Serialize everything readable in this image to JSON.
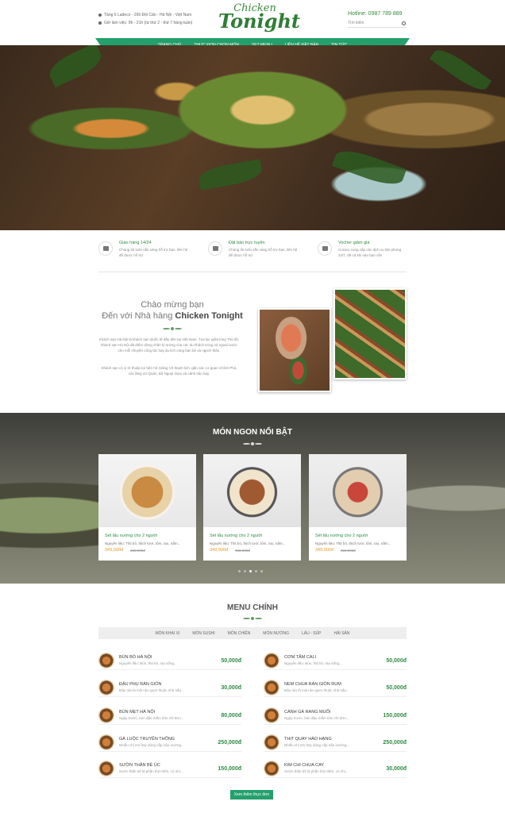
{
  "header": {
    "address": "Tầng 6 Ladeco - 266 Đội Cấn - Hà Nội - Việt Nam",
    "hours": "Giờ làm việc: 9h - 21h (từ thứ 2 - thứ 7 hàng tuần)",
    "logo_line1": "Chicken",
    "logo_line2": "Tonight",
    "hotline": "Hotline: 0987 789 889",
    "search_placeholder": "Tìm kiếm"
  },
  "nav": [
    "TRANG CHỦ",
    "THỰC ĐƠN CHỌN MÓN",
    "SET MENU",
    "LIÊN HỆ ĐẶT BÀN",
    "TIN TỨC"
  ],
  "features": [
    {
      "title": "Giao hàng 14/24",
      "desc": "Chúng tôi luôn sẵn sàng hỗ trợ bạn, liên hệ để được hỗ trợ",
      "icon": "delivery-icon"
    },
    {
      "title": "Đặt bàn trực tuyến",
      "desc": "Chúng tôi luôn sẵn sàng hỗ trợ bạn, liên hệ để được hỗ trợ",
      "icon": "table-icon"
    },
    {
      "title": "Vocher giảm giá",
      "desc": "Coravo cung cấp các dịch vụ tận phòng 24/7, tất cả khi nào bạn cần",
      "icon": "voucher-icon"
    }
  ],
  "welcome": {
    "line1": "Chào mừng bạn",
    "line2_prefix": "Đến với Nhà hàng ",
    "line2_brand": "Chicken Tonight",
    "para1": "Khách sạn Hà Nội là khách sạn Quốc tế đầu tiên tại Việt Nam. Tọa lạc giữa lòng Thủ đô, khách sạn Hà Nội đã điểm dừng chân lý tưởng của các du khách trong và ngoài nước cho mỗi chuyến công tác hay du lịch cùng bạn bè và người thân.",
    "para2": "Khách sạn có vị trí thuận lợi bên hồ Giảng Võ thanh lịch, gần các cơ quan Chính Phủ, các lăng sứ Quán, Bộ Ngoại Giao và cảnh sân bay."
  },
  "featured": {
    "title": "MÓN NGON NỔI BẬT",
    "cards": [
      {
        "name": "Sét lẩu nướng cho 2 người",
        "desc": "Nguyên liệu: Thịt bò, thịch tươi, tôm, rau, nấm...",
        "price": "349,000đ",
        "old_price": "450,000đ"
      },
      {
        "name": "Sét lẩu nướng cho 2 người",
        "desc": "Nguyên liệu: Thịt bò, thịch tươi, tôm, rau, nấm...",
        "price": "349,000đ",
        "old_price": "450,000đ"
      },
      {
        "name": "Sét lẩu nướng cho 2 người",
        "desc": "Nguyên liệu: Thịt bò, thịch tươi, tôm, rau, nấm...",
        "price": "349,000đ",
        "old_price": "450,000đ"
      }
    ]
  },
  "menu": {
    "title": "MENU CHÍNH",
    "tabs": [
      "MÓN KHAI VỊ",
      "MÓN SUSHI",
      "MÓN CHIÊN",
      "MÓN NƯỚNG",
      "LẨU - SÚP",
      "HẢI SẢN"
    ],
    "left": [
      {
        "name": "BÚN BÒ HÀ NỘI",
        "desc": "Nguyên liệu: Bún, thịt bò, rau sống...",
        "price": "50,000đ"
      },
      {
        "name": "ĐẬU PHỤ RÁN GIÒN",
        "desc": "Đậu rán là món ăn quen thuộc nhà nấu...",
        "price": "30,000đ"
      },
      {
        "name": "BÚN MẸT HÀ NỘI",
        "desc": "Ngày trước, bún đậu mắm tôm chỉ đơn...",
        "price": "80,000đ"
      },
      {
        "name": "GÀ LUỘC TRUYỀN THỐNG",
        "desc": "Nhiều chị em hay dùng cấp nấu nướng...",
        "price": "250,000đ"
      },
      {
        "name": "SƯỜN THĂN BÊ ÚC",
        "desc": "Sườn thăn bê là phần thịt mềm, có nhi...",
        "price": "150,000đ"
      }
    ],
    "right": [
      {
        "name": "CƠM TẤM CALI",
        "desc": "Nguyên liệu: Bún, thịt bò, rau sống...",
        "price": "50,000đ"
      },
      {
        "name": "NEM CHUA RÁN GIÒN RUM",
        "desc": "Đậu rán là món ăn quen thuộc nhà nấu...",
        "price": "50,000đ"
      },
      {
        "name": "CÁNH GÀ RANG MUỐI",
        "desc": "Ngày trước, bún đậu mắm tôm chỉ đơn...",
        "price": "150,000đ"
      },
      {
        "name": "THỊT QUAY HÀO HẠNG",
        "desc": "Nhiều chị em hay dùng cấp nấu nướng...",
        "price": "250,000đ"
      },
      {
        "name": "KIM CHI CHUA CAY",
        "desc": "Sườn thăn bê là phần thịt mềm, có nhi...",
        "price": "30,000đ"
      }
    ],
    "more_button": "Xem thêm thực đơn"
  },
  "colors": {
    "brand_green": "#23a06b",
    "price_orange": "#e39a2a"
  }
}
